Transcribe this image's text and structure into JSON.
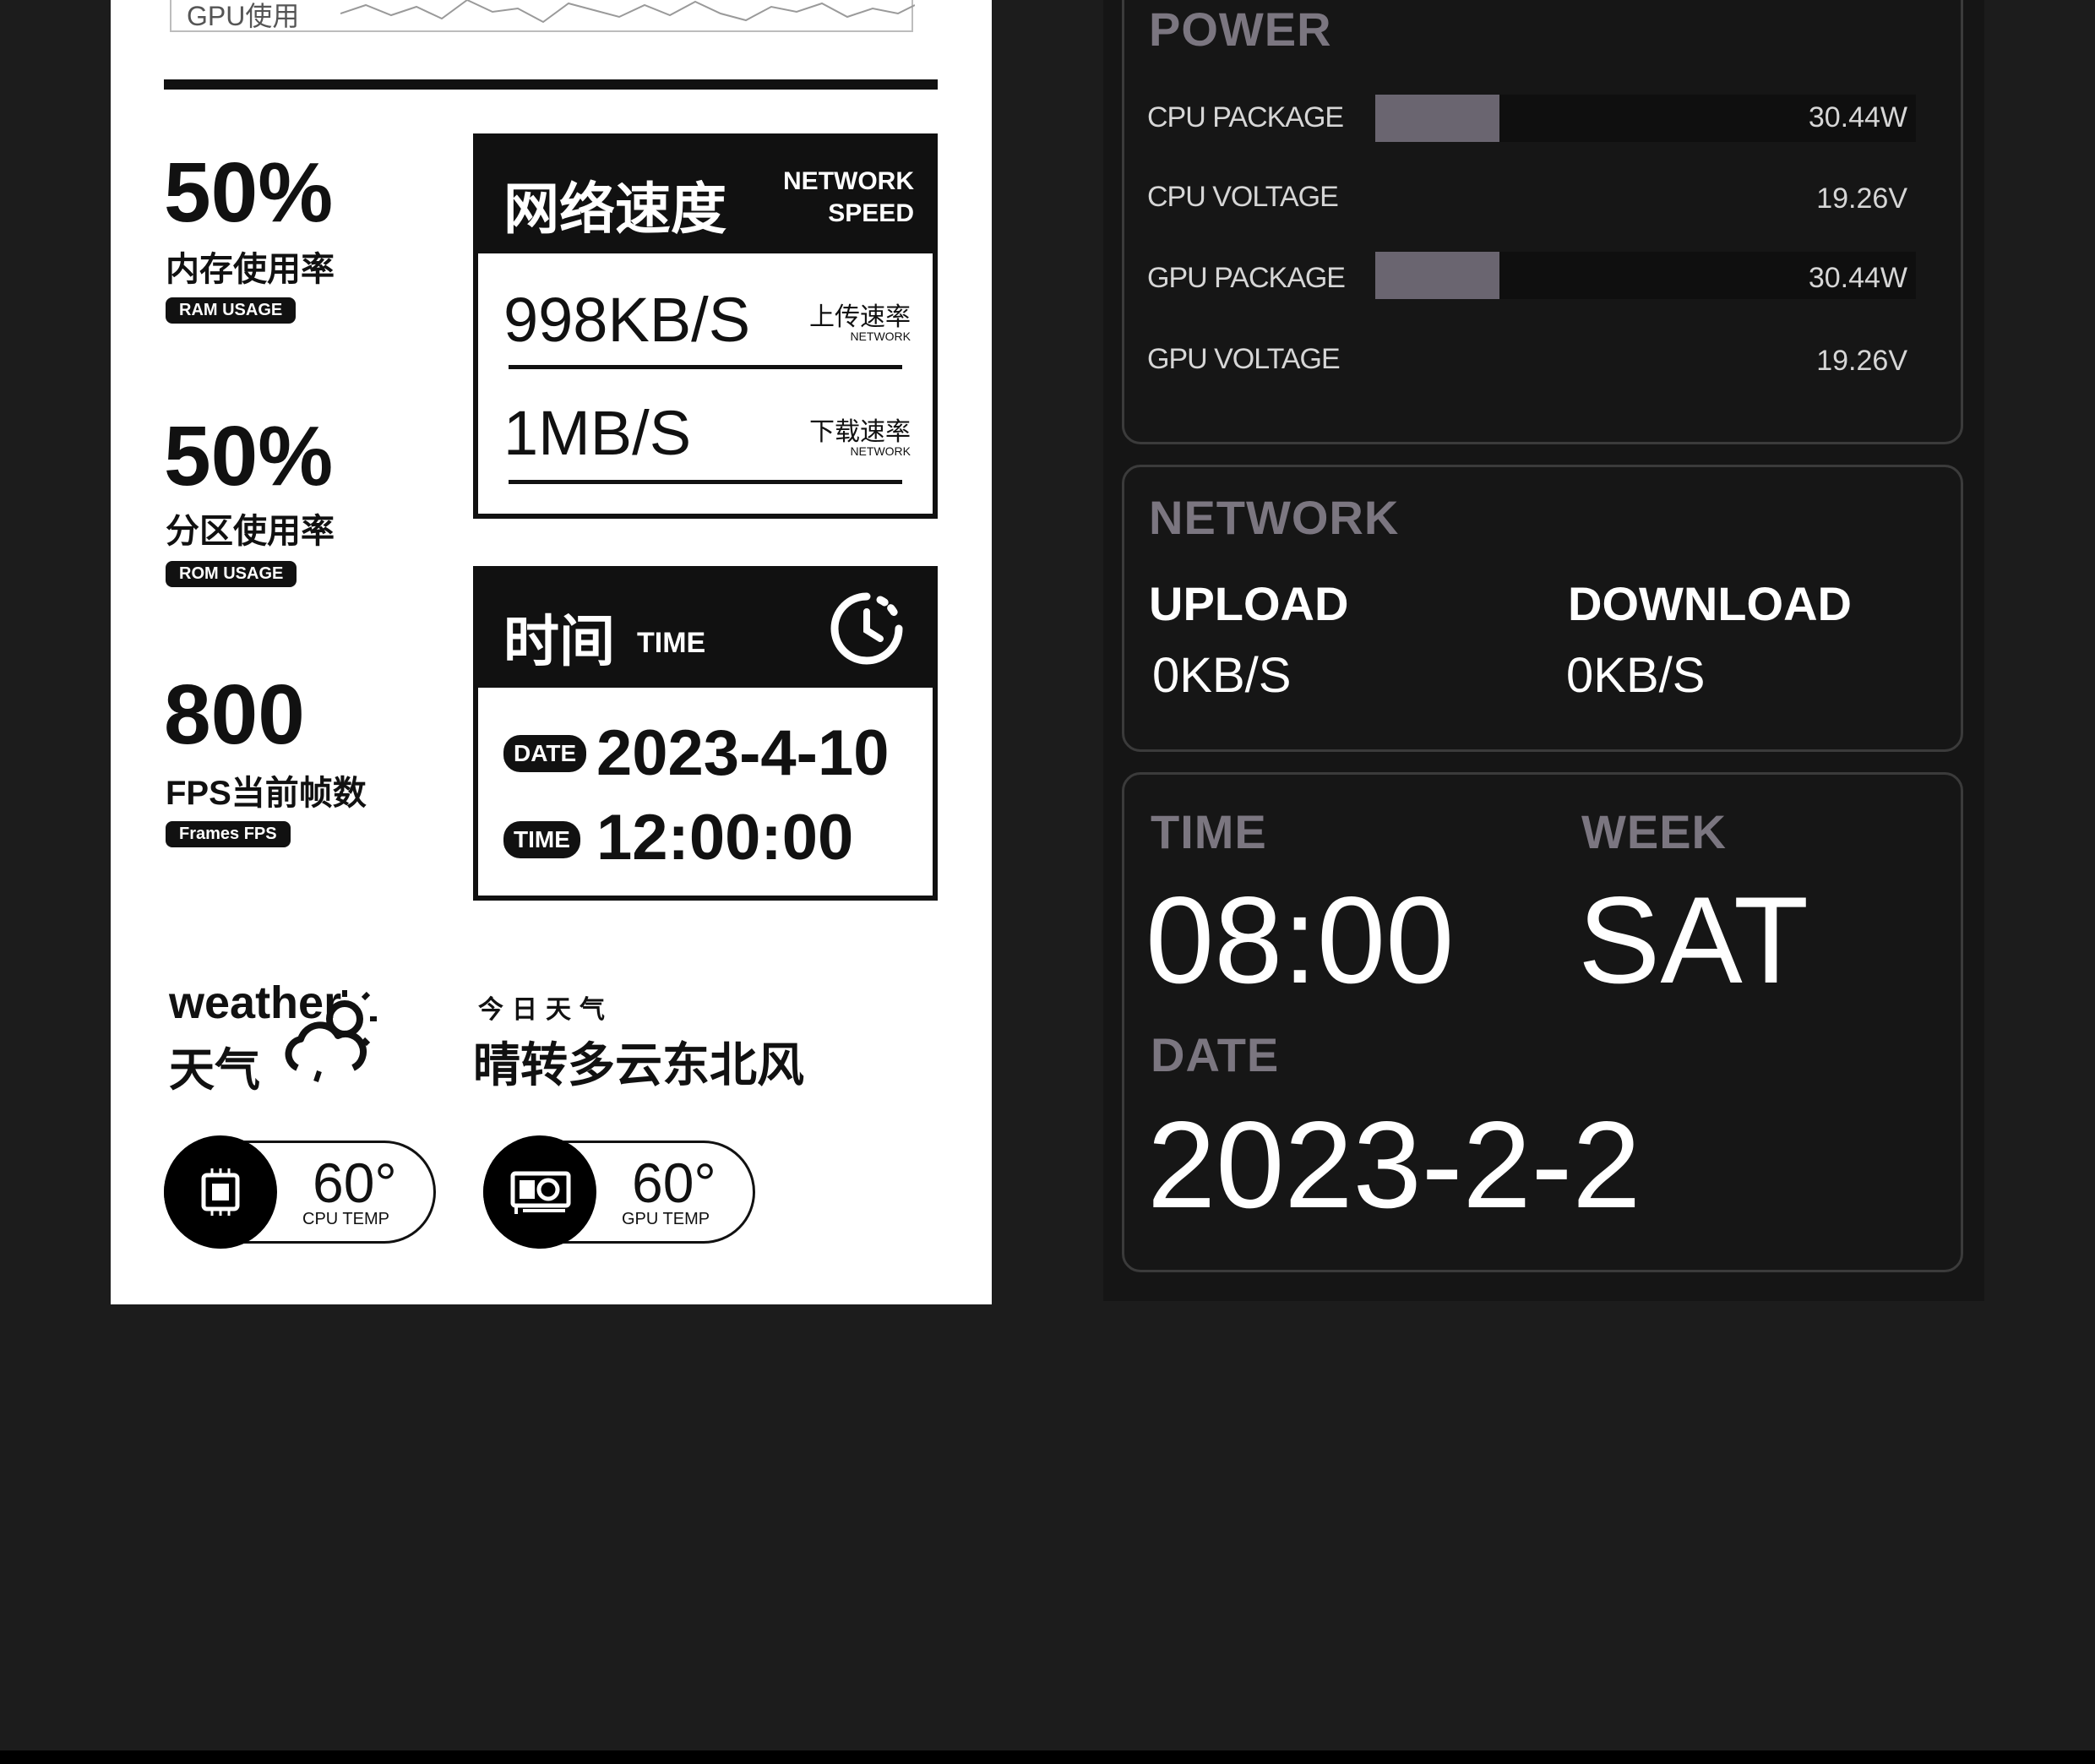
{
  "gpu_chart": {
    "label": "GPU使用"
  },
  "stats": [
    {
      "value": "50%",
      "label_cn": "内存使用率",
      "pill": "RAM USAGE"
    },
    {
      "value": "50%",
      "label_cn": "分区使用率",
      "pill": "ROM USAGE"
    },
    {
      "value": "800",
      "label_cn": "FPS当前帧数",
      "pill": "Frames FPS"
    }
  ],
  "network_box": {
    "title_cn": "网络速度",
    "title_en_1": "NETWORK",
    "title_en_2": "SPEED",
    "upload_value": "998KB/S",
    "upload_label_cn": "上传速率",
    "upload_label_en": "NETWORK",
    "download_value": "1MB/S",
    "download_label_cn": "下载速率",
    "download_label_en": "NETWORK"
  },
  "time_box": {
    "title_cn": "时间",
    "title_en": "TIME",
    "date_tag": "DATE",
    "date_value": "2023-4-10",
    "time_tag": "TIME",
    "time_value": "12:00:00"
  },
  "weather": {
    "label_en": "weather",
    "label_cn": "天气",
    "today_label": "今日天气",
    "condition": "晴转多云东北风"
  },
  "temps": [
    {
      "value": "60°",
      "label": "CPU TEMP",
      "icon": "cpu-chip-icon"
    },
    {
      "value": "60°",
      "label": "GPU TEMP",
      "icon": "graphics-card-icon"
    }
  ],
  "power_card": {
    "title": "POWER",
    "rows": [
      {
        "label": "CPU PACKAGE",
        "value": "30.44W",
        "bar": true,
        "fill_fraction": 0.23
      },
      {
        "label": "CPU VOLTAGE",
        "value": "19.26V",
        "bar": false
      },
      {
        "label": "GPU PACKAGE",
        "value": "30.44W",
        "bar": true,
        "fill_fraction": 0.23
      },
      {
        "label": "GPU VOLTAGE",
        "value": "19.26V",
        "bar": false
      }
    ]
  },
  "network_card": {
    "title": "NETWORK",
    "upload_label": "UPLOAD",
    "upload_value": "0KB/S",
    "download_label": "DOWNLOAD",
    "download_value": "0KB/S"
  },
  "time_card": {
    "time_label": "TIME",
    "time_value": "08:00",
    "week_label": "WEEK",
    "week_value": "SAT",
    "date_label": "DATE",
    "date_value": "2023-2-2"
  },
  "colors": {
    "page_bg": "#1c1c1c",
    "white_panel": "#ffffff",
    "dark_panel": "#151515",
    "card_title": "#7b7680",
    "bar_fill": "#6a6570"
  }
}
